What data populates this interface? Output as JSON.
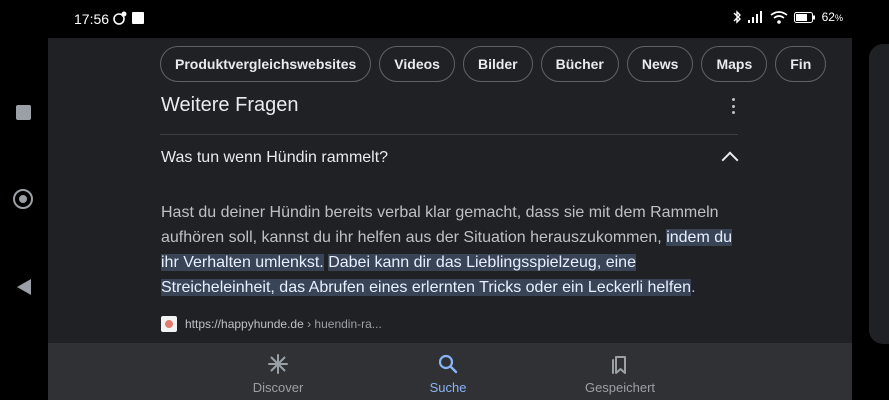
{
  "status": {
    "time": "17:56",
    "battery": "62"
  },
  "chips": [
    "Produktvergleichswebsites",
    "Videos",
    "Bilder",
    "Bücher",
    "News",
    "Maps",
    "Fin"
  ],
  "card": {
    "title": "Weitere Fragen",
    "question": "Was tun wenn Hündin rammelt?",
    "answer_plain": "Hast du deiner Hündin bereits verbal klar gemacht, dass sie mit dem Rammeln aufhören soll, kannst du ihr helfen aus der Situation herauszukommen, ",
    "answer_highlight_1": "indem du ihr Verhalten umlenkst.",
    "answer_highlight_2": "Dabei kann dir das Lieblingsspielzeug, eine Streicheleinheit, das Abrufen eines erlernten Tricks oder ein Leckerli helfen",
    "answer_end": ".",
    "source_url": "https://happyhunde.de",
    "source_path": " › huendin-ra..."
  },
  "bottom_nav": {
    "discover": "Discover",
    "search": "Suche",
    "saved": "Gespeichert"
  },
  "colors": {
    "accent": "#8ab4f8",
    "highlight": "#394457"
  }
}
